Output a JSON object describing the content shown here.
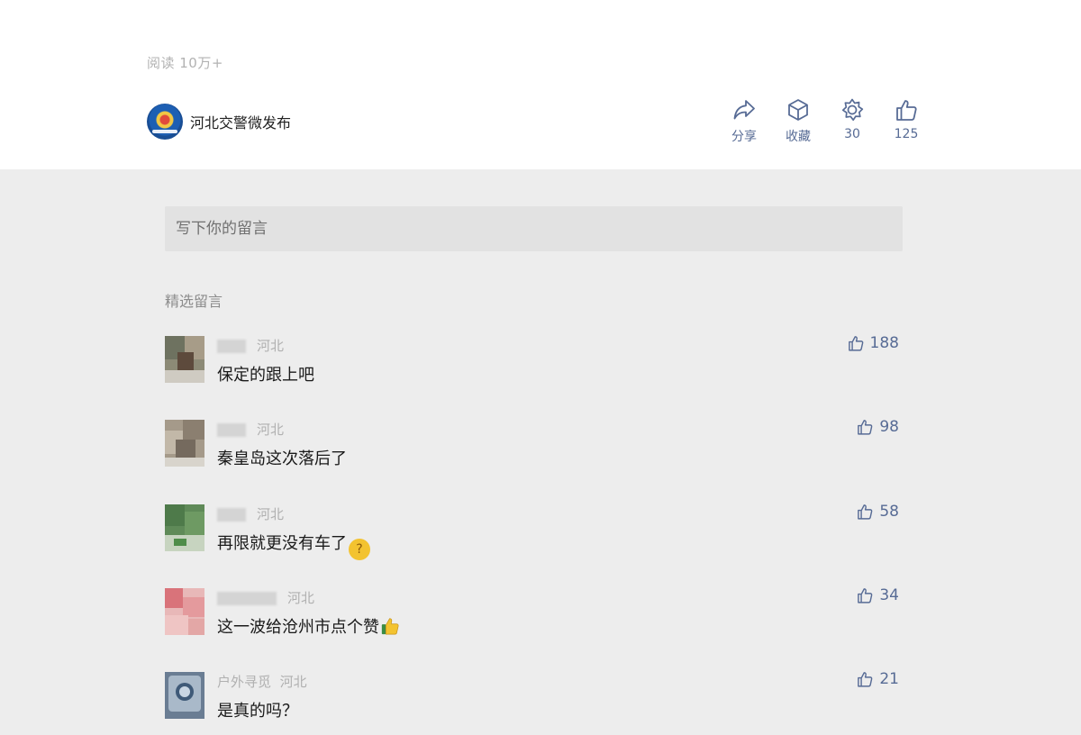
{
  "article": {
    "read_count": "阅读 10万+",
    "account_name": "河北交警微发布",
    "actions": [
      {
        "label": "分享",
        "icon": "share-icon"
      },
      {
        "label": "收藏",
        "icon": "favorite-icon"
      },
      {
        "label": "30",
        "icon": "wow-icon"
      },
      {
        "label": "125",
        "icon": "like-icon"
      }
    ]
  },
  "comment_input": {
    "placeholder": "写下你的留言"
  },
  "comments_section": {
    "title": "精选留言",
    "items": [
      {
        "location": "河北",
        "text": "保定的跟上吧",
        "likes": "188"
      },
      {
        "location": "河北",
        "text": "秦皇岛这次落后了",
        "likes": "98"
      },
      {
        "location": "河北",
        "text": "再限就更没有车了",
        "likes": "58",
        "emoji": "thinking-face"
      },
      {
        "location": "河北",
        "text": "这一波给沧州市点个赞",
        "likes": "34",
        "emoji": "thumbs-up"
      },
      {
        "nickname": "户外寻觅",
        "location": "河北",
        "text": "是真的吗？",
        "likes": "21"
      }
    ]
  },
  "colors": {
    "accent": "#576b95",
    "page_bg": "#ededed",
    "top_bg": "#ffffff",
    "input_bg": "#e2e2e2"
  }
}
